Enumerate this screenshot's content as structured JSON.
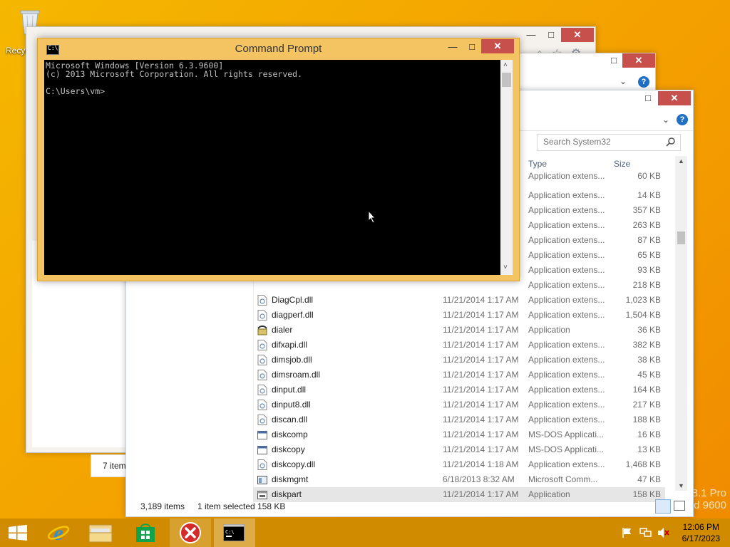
{
  "desktop": {
    "recycle_label": "Recyc",
    "watermark_line1": "8.1 Pro",
    "watermark_line2": "d 9600"
  },
  "back_window": {
    "status_items": "7 item"
  },
  "explorer": {
    "search_placeholder": "Search System32",
    "columns": {
      "type": "Type",
      "size": "Size"
    },
    "rows": [
      {
        "name": "",
        "date": "",
        "type": "Application extens...",
        "size": "60 KB",
        "icon": "dll-icon",
        "partial": true
      },
      {
        "name": "",
        "date": "",
        "type": "Application extens...",
        "size": "14 KB",
        "icon": "dll-icon"
      },
      {
        "name": "",
        "date": "",
        "type": "Application extens...",
        "size": "357 KB",
        "icon": "dll-icon"
      },
      {
        "name": "",
        "date": "",
        "type": "Application extens...",
        "size": "263 KB",
        "icon": "dll-icon"
      },
      {
        "name": "",
        "date": "",
        "type": "Application extens...",
        "size": "87 KB",
        "icon": "dll-icon"
      },
      {
        "name": "",
        "date": "",
        "type": "Application extens...",
        "size": "65 KB",
        "icon": "dll-icon"
      },
      {
        "name": "",
        "date": "",
        "type": "Application extens...",
        "size": "93 KB",
        "icon": "dll-icon"
      },
      {
        "name": "",
        "date": "",
        "type": "Application extens...",
        "size": "218 KB",
        "icon": "dll-icon"
      },
      {
        "name": "DiagCpl.dll",
        "date": "11/21/2014 1:17 AM",
        "type": "Application extens...",
        "size": "1,023 KB",
        "icon": "dll-icon"
      },
      {
        "name": "diagperf.dll",
        "date": "11/21/2014 1:17 AM",
        "type": "Application extens...",
        "size": "1,504 KB",
        "icon": "dll-icon"
      },
      {
        "name": "dialer",
        "date": "11/21/2014 1:17 AM",
        "type": "Application",
        "size": "36 KB",
        "icon": "phone-icon"
      },
      {
        "name": "difxapi.dll",
        "date": "11/21/2014 1:17 AM",
        "type": "Application extens...",
        "size": "382 KB",
        "icon": "dll-icon"
      },
      {
        "name": "dimsjob.dll",
        "date": "11/21/2014 1:17 AM",
        "type": "Application extens...",
        "size": "38 KB",
        "icon": "dll-icon"
      },
      {
        "name": "dimsroam.dll",
        "date": "11/21/2014 1:17 AM",
        "type": "Application extens...",
        "size": "45 KB",
        "icon": "dll-icon"
      },
      {
        "name": "dinput.dll",
        "date": "11/21/2014 1:17 AM",
        "type": "Application extens...",
        "size": "164 KB",
        "icon": "dll-icon"
      },
      {
        "name": "dinput8.dll",
        "date": "11/21/2014 1:17 AM",
        "type": "Application extens...",
        "size": "217 KB",
        "icon": "dll-icon"
      },
      {
        "name": "discan.dll",
        "date": "11/21/2014 1:17 AM",
        "type": "Application extens...",
        "size": "188 KB",
        "icon": "dll-icon"
      },
      {
        "name": "diskcomp",
        "date": "11/21/2014 1:17 AM",
        "type": "MS-DOS Applicati...",
        "size": "16 KB",
        "icon": "msdos-icon"
      },
      {
        "name": "diskcopy",
        "date": "11/21/2014 1:17 AM",
        "type": "MS-DOS Applicati...",
        "size": "13 KB",
        "icon": "msdos-icon"
      },
      {
        "name": "diskcopy.dll",
        "date": "11/21/2014 1:18 AM",
        "type": "Application extens...",
        "size": "1,468 KB",
        "icon": "dll-icon"
      },
      {
        "name": "diskmgmt",
        "date": "6/18/2013 8:32 AM",
        "type": "Microsoft Comm...",
        "size": "47 KB",
        "icon": "mmc-icon"
      },
      {
        "name": "diskpart",
        "date": "11/21/2014 1:17 AM",
        "type": "Application",
        "size": "158 KB",
        "icon": "app-icon",
        "selected": true
      }
    ],
    "status": {
      "count": "3,189 items",
      "selected": "1 item selected",
      "size": "158 KB"
    }
  },
  "cmd": {
    "title": "Command Prompt",
    "lines": "Microsoft Windows [Version 6.3.9600]\n(c) 2013 Microsoft Corporation. All rights reserved.\n\nC:\\Users\\vm>"
  },
  "taskbar": {
    "time": "12:06 PM",
    "date": "6/17/2023"
  },
  "colors": {
    "taskbar": "#d08b00",
    "cmd_frame": "#f4c463",
    "close_red": "#c7504c"
  }
}
